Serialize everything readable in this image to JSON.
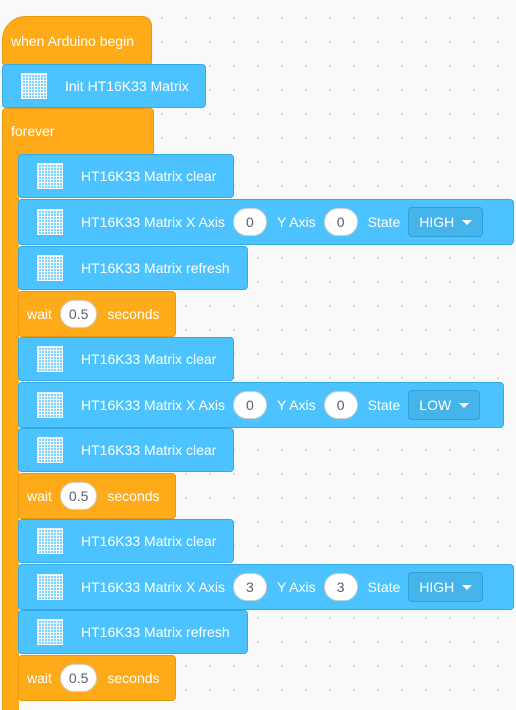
{
  "hat_label": "when Arduino begin",
  "init_label": "Init HT16K33 Matrix",
  "forever_label": "forever",
  "clear_label": "HT16K33 Matrix clear",
  "refresh_label": "HT16K33 Matrix refresh",
  "xaxis_label": "HT16K33 Matrix X Axis",
  "yaxis_label": "Y Axis",
  "state_label": "State",
  "wait_label": "wait",
  "seconds_label": "seconds",
  "set1": {
    "x": "0",
    "y": "0",
    "state": "HIGH"
  },
  "set2": {
    "x": "0",
    "y": "0",
    "state": "LOW"
  },
  "set3": {
    "x": "3",
    "y": "3",
    "state": "HIGH"
  },
  "wait1": "0.5",
  "wait2": "0.5",
  "wait3": "0.5",
  "colors": {
    "event": "#ffab19",
    "extension": "#4cc3ff",
    "control": "#ffab19"
  }
}
